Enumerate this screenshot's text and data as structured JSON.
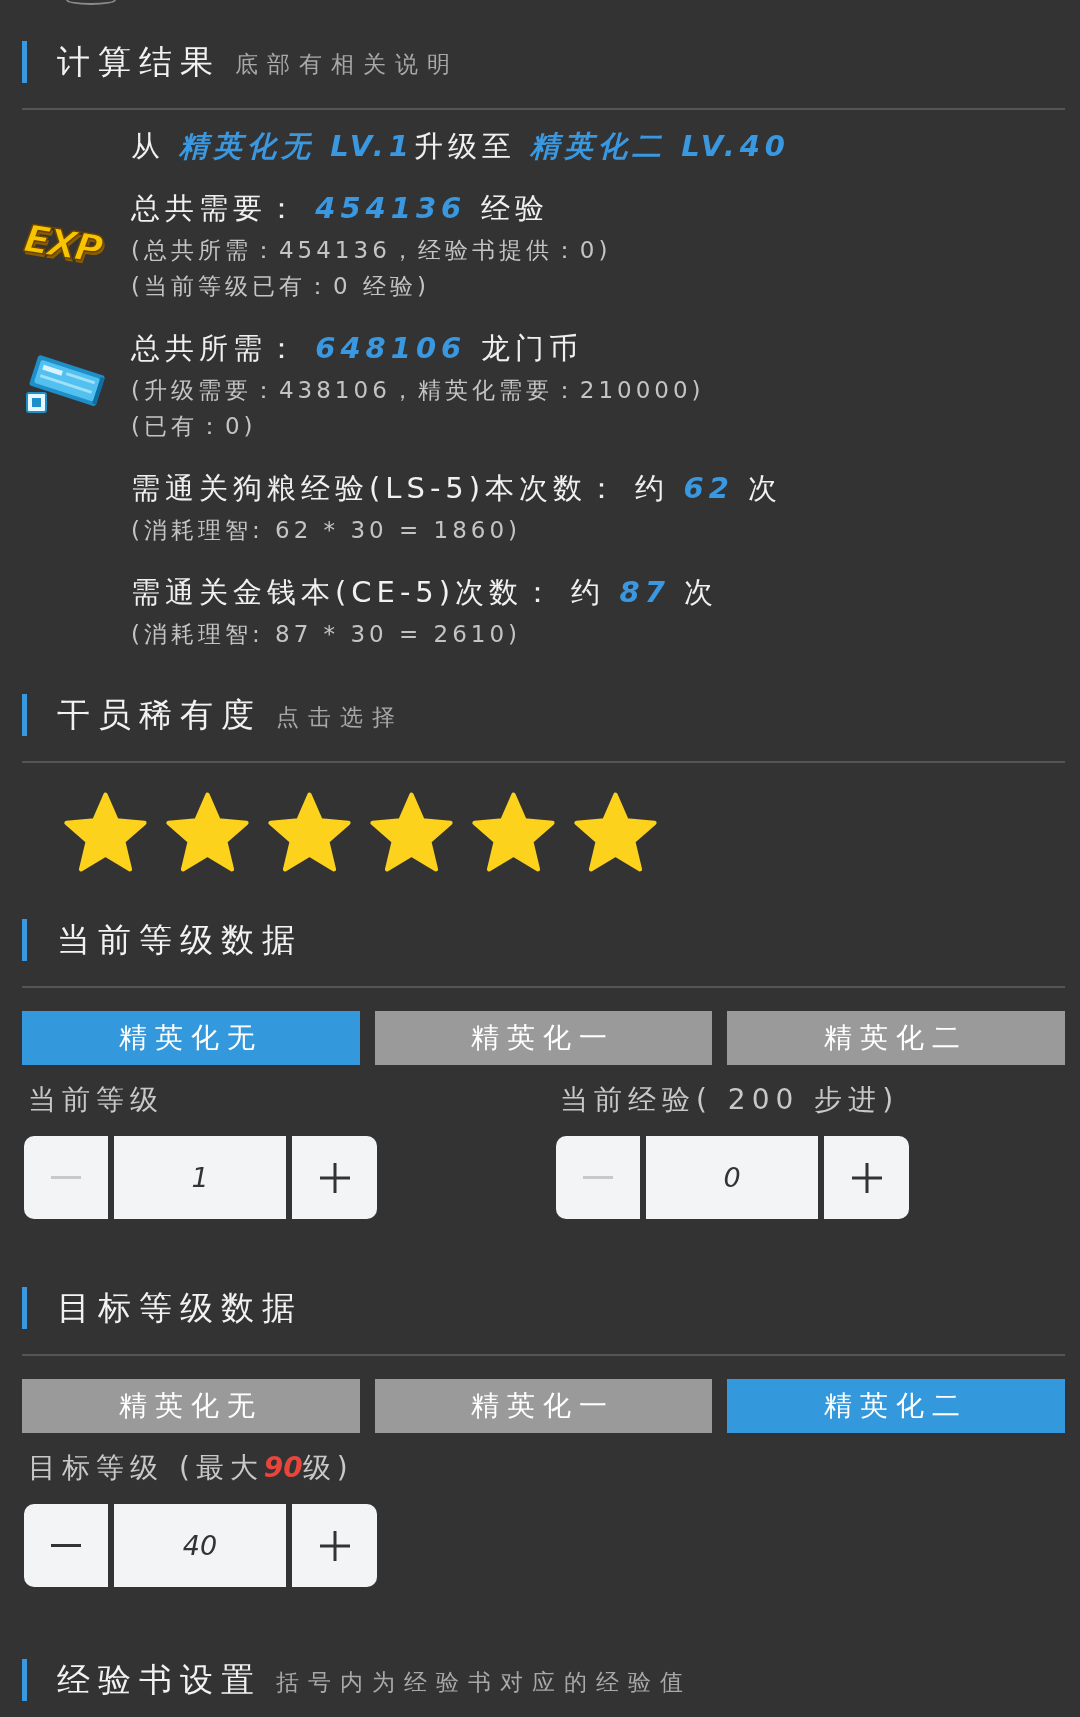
{
  "sections": [
    {
      "kind": "results",
      "header": {
        "title": "计算结果",
        "note": "底部有相关说明"
      },
      "route": "从 **精英化无 LV.1**升级至 **精英化二 LV.40**",
      "groups": [
        {
          "kind": "exp",
          "badge": "EXP",
          "main": "总共需要： **454136** 经验",
          "details": [
            "(总共所需：454136，经验书提供：0)",
            "(当前等级已有：0 经验)"
          ]
        },
        {
          "kind": "money",
          "main": "总共所需： **648106** 龙门币",
          "details": [
            "(升级需要：438106，精英化需要：210000)",
            "(已有：0)"
          ]
        },
        {
          "kind": "runs",
          "main": "需通关狗粮经验(LS-5)本次数： 约 **62** 次",
          "details": [
            "(消耗理智: 62 * 30 = 1860)"
          ]
        },
        {
          "kind": "runs",
          "main": "需通关金钱本(CE-5)次数： 约 **87** 次",
          "details": [
            "(消耗理智: 87 * 30 = 2610)"
          ]
        }
      ]
    },
    {
      "kind": "rarity",
      "header": {
        "title": "干员稀有度",
        "note": "点击选择"
      },
      "stars": 6
    },
    {
      "kind": "level",
      "header": {
        "title": "当前等级数据"
      },
      "tabs": [
        {
          "label": "精英化无",
          "selected": true
        },
        {
          "label": "精英化一",
          "selected": false
        },
        {
          "label": "精英化二",
          "selected": false
        }
      ],
      "fields": [
        {
          "label": "当前等级",
          "value": "1",
          "minus_disabled": true
        },
        {
          "label": "当前经验( 200 步进)",
          "value": "0",
          "minus_disabled": true
        }
      ]
    },
    {
      "kind": "level",
      "header": {
        "title": "目标等级数据"
      },
      "tabs": [
        {
          "label": "精英化无",
          "selected": false
        },
        {
          "label": "精英化一",
          "selected": false
        },
        {
          "label": "精英化二",
          "selected": true
        }
      ],
      "fields": [
        {
          "label": "目标等级 (最大**90**级)",
          "value": "40",
          "minus_disabled": false
        }
      ]
    },
    {
      "kind": "books",
      "header": {
        "title": "经验书设置",
        "note": "括号内为经验书对应的经验值"
      }
    }
  ]
}
